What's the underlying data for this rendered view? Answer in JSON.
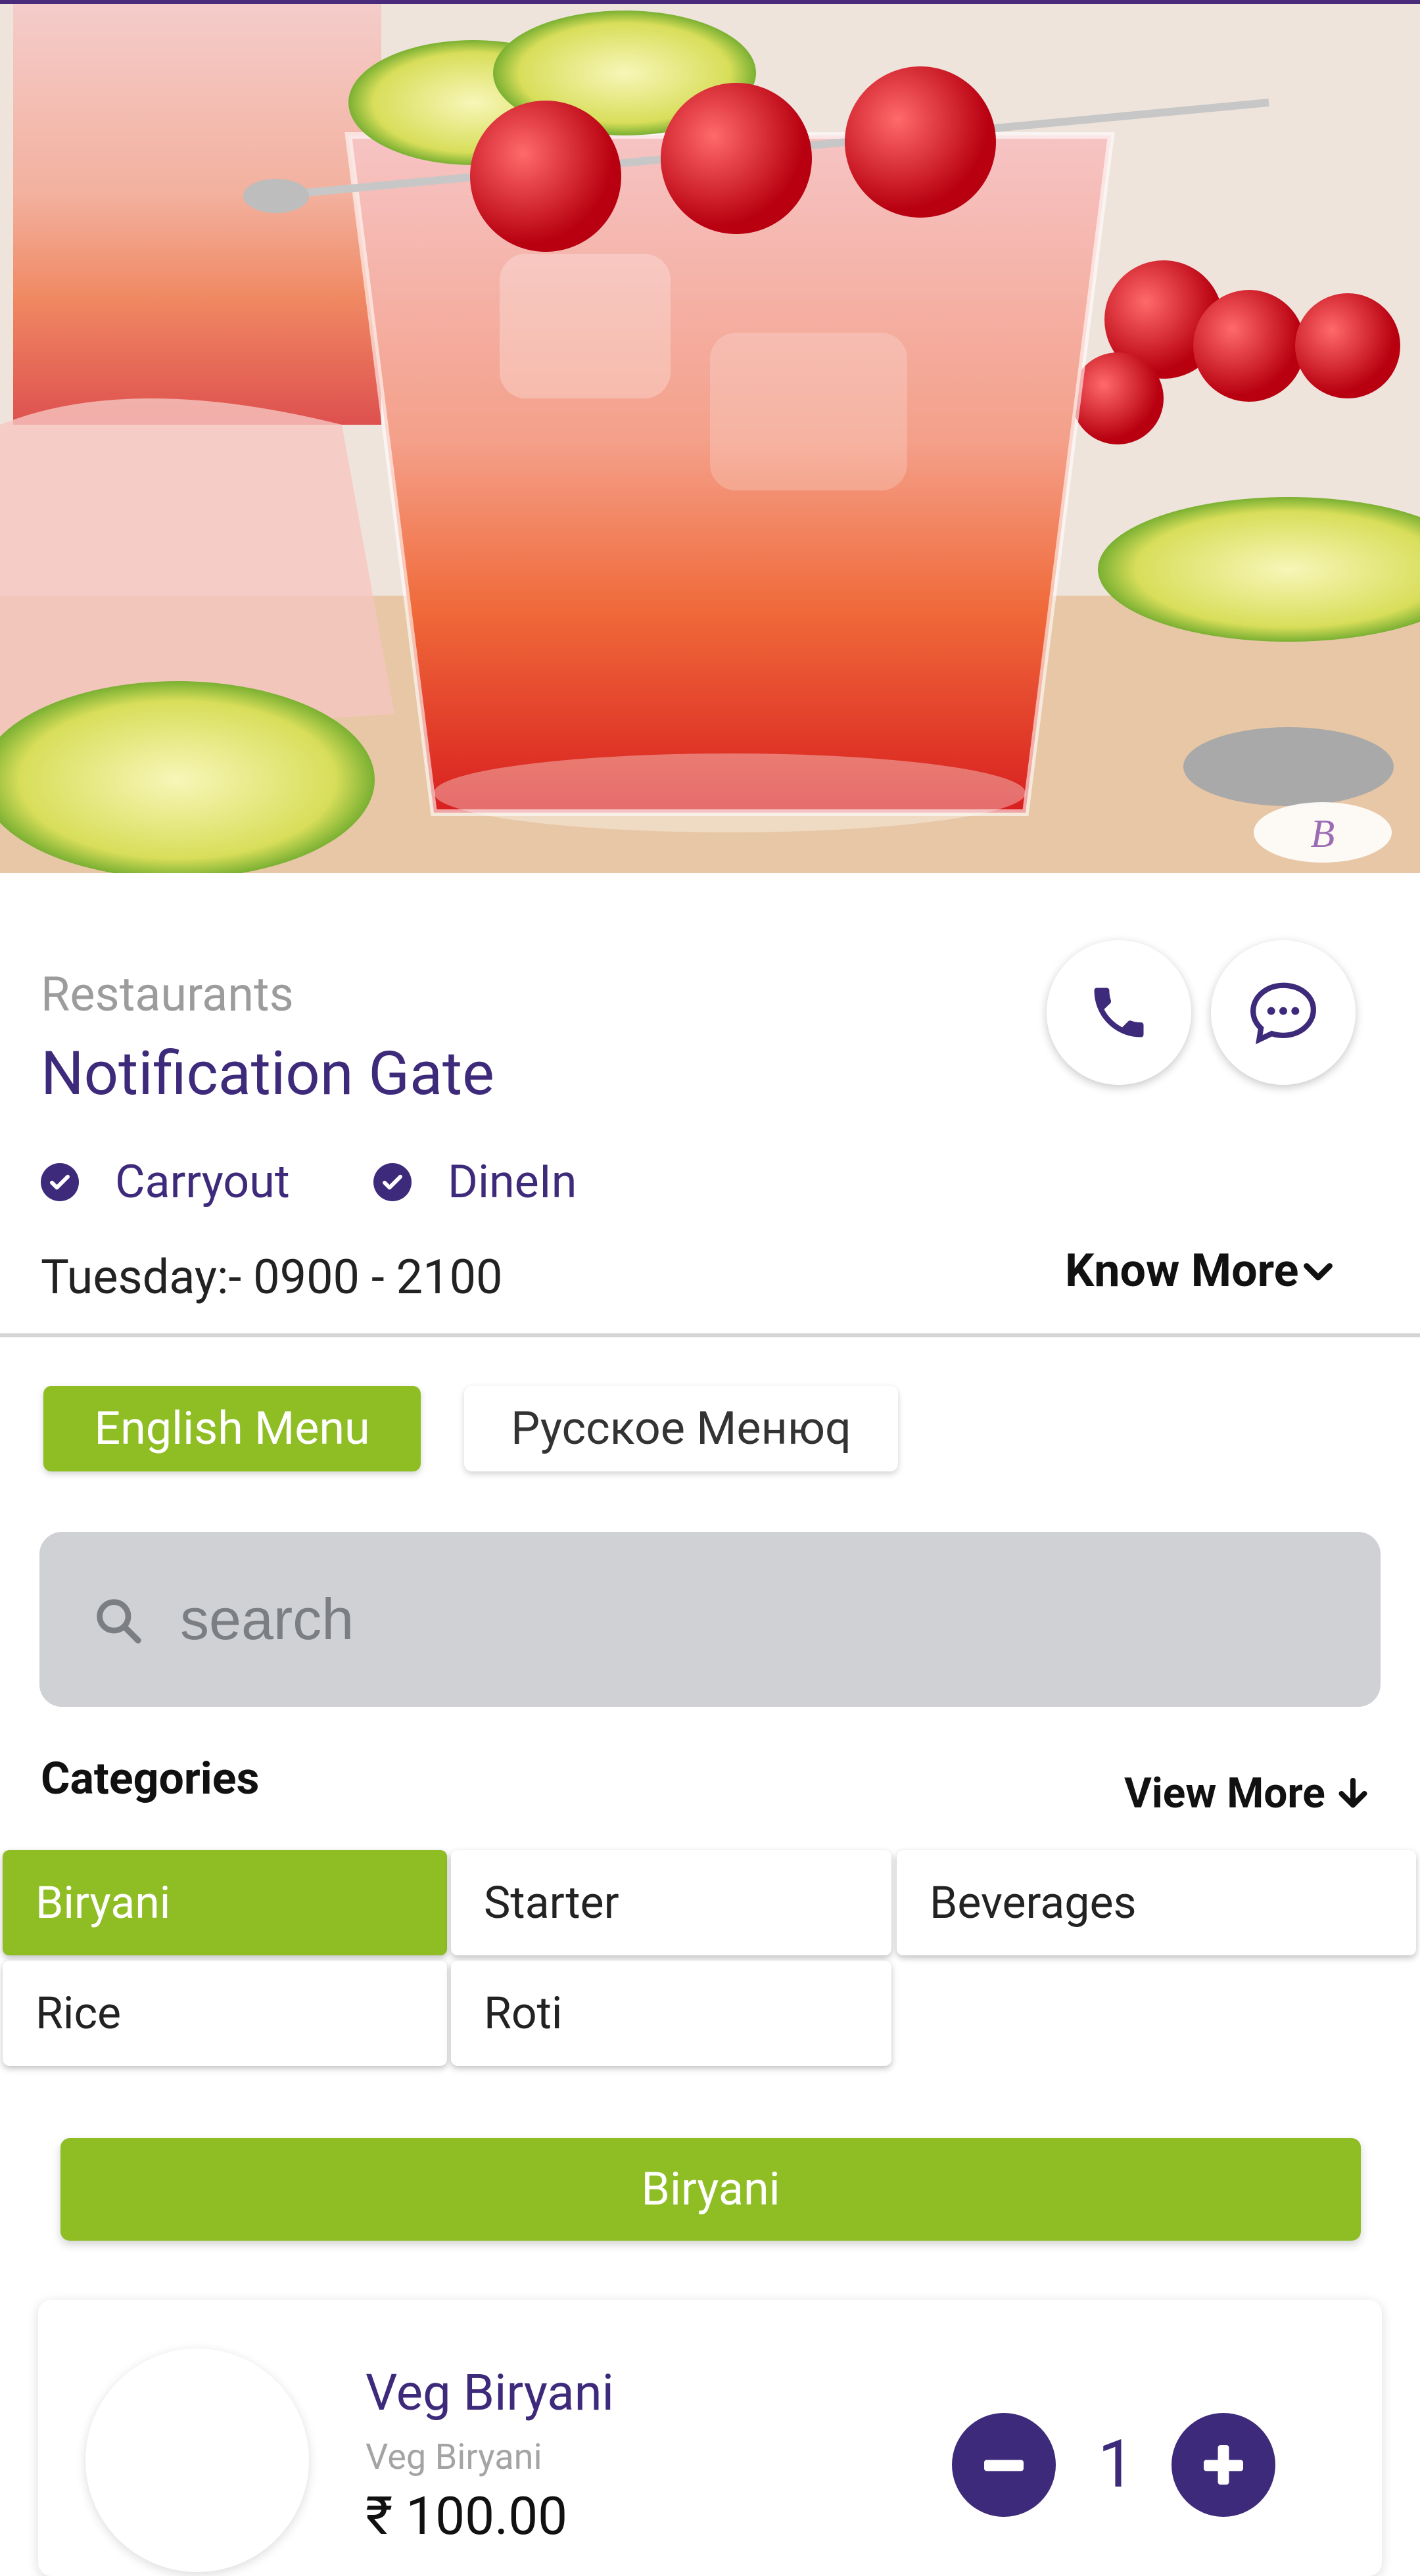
{
  "hero": {
    "alt": "drink-photo",
    "badge_icon": "logo-badge"
  },
  "header": {
    "subtitle": "Restaurants",
    "title": "Notification Gate",
    "call_icon": "phone-icon",
    "chat_icon": "chat-icon"
  },
  "services": [
    {
      "label": "Carryout",
      "icon": "check-circle-icon"
    },
    {
      "label": "DineIn",
      "icon": "check-circle-icon"
    }
  ],
  "hours": {
    "text": "Tuesday:-  0900 - 2100",
    "know_more": "Know More"
  },
  "menu_tabs": [
    {
      "label": "English Menu",
      "active": true
    },
    {
      "label": "Русское Менюq",
      "active": false
    }
  ],
  "search": {
    "placeholder": "search"
  },
  "categories": {
    "title": "Categories",
    "view_more": "View More",
    "items": [
      {
        "label": "Biryani",
        "active": true
      },
      {
        "label": "Starter",
        "active": false
      },
      {
        "label": "Beverages",
        "active": false
      },
      {
        "label": "Rice",
        "active": false
      },
      {
        "label": "Roti",
        "active": false
      }
    ]
  },
  "section": {
    "title": "Biryani"
  },
  "product": {
    "name": "Veg Biryani",
    "subtitle": "Veg Biryani",
    "price": "₹ 100.00",
    "quantity": "1"
  },
  "colors": {
    "accent": "#8ebd24",
    "brand": "#3e2a7a"
  }
}
